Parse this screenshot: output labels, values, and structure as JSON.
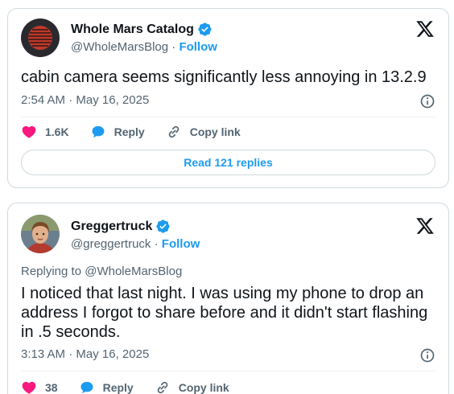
{
  "colors": {
    "accent": "#1d9bf0",
    "like": "#f91880",
    "text": "#0f1419",
    "muted": "#536471",
    "border": "#cfd9de"
  },
  "tweets": [
    {
      "author": {
        "name": "Whole Mars Catalog",
        "handle": "@WholeMarsBlog",
        "separator": "·",
        "follow_label": "Follow",
        "avatar_icon": "mars-logo-avatar",
        "verified_icon": "verified-badge-icon"
      },
      "text": "cabin camera seems significantly less annoying in 13.2.9",
      "time": "2:54 AM",
      "date": "May 16, 2025",
      "likes": "1.6K",
      "reply_label": "Reply",
      "copy_label": "Copy link",
      "read_replies_label": "Read 121 replies"
    },
    {
      "author": {
        "name": "Greggertruck",
        "handle": "@greggertruck",
        "separator": "·",
        "follow_label": "Follow",
        "avatar_icon": "profile-photo-avatar",
        "verified_icon": "verified-badge-icon"
      },
      "replying_to": "Replying to @WholeMarsBlog",
      "text": "I noticed that last night. I was using my phone to drop an address I forgot to share before and it didn't start flashing in .5 seconds.",
      "time": "3:13 AM",
      "date": "May 16, 2025",
      "likes": "38",
      "reply_label": "Reply",
      "copy_label": "Copy link"
    }
  ]
}
